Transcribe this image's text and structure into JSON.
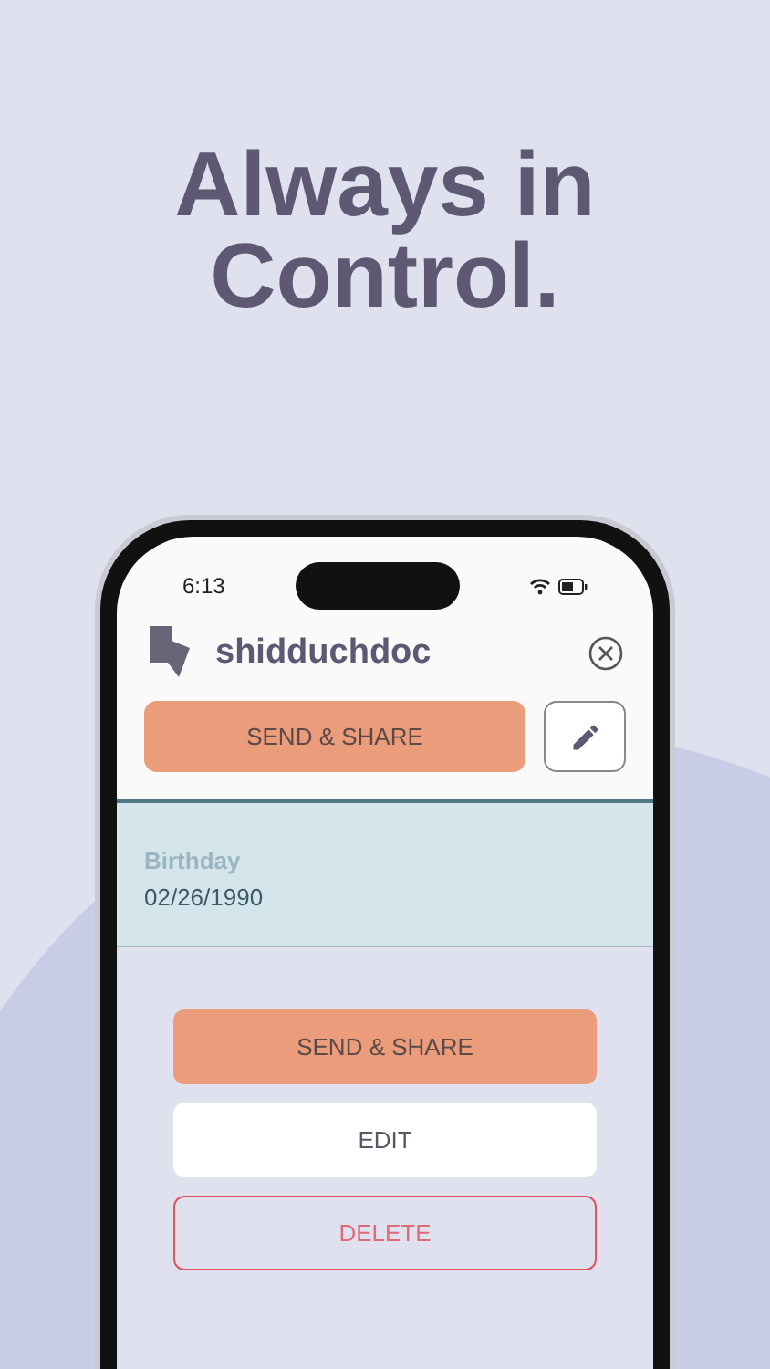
{
  "headline": [
    "Always in",
    "Control."
  ],
  "status_bar": {
    "time": "6:13"
  },
  "header": {
    "app_name": "shidduchdoc"
  },
  "toolbar": {
    "primary_button": "SEND & SHARE"
  },
  "field": {
    "label": "Birthday",
    "value": "02/26/1990"
  },
  "actions": [
    {
      "kind": "primary",
      "label": "SEND & SHARE"
    },
    {
      "kind": "secondary",
      "label": "EDIT"
    },
    {
      "kind": "danger",
      "label": "DELETE"
    }
  ]
}
